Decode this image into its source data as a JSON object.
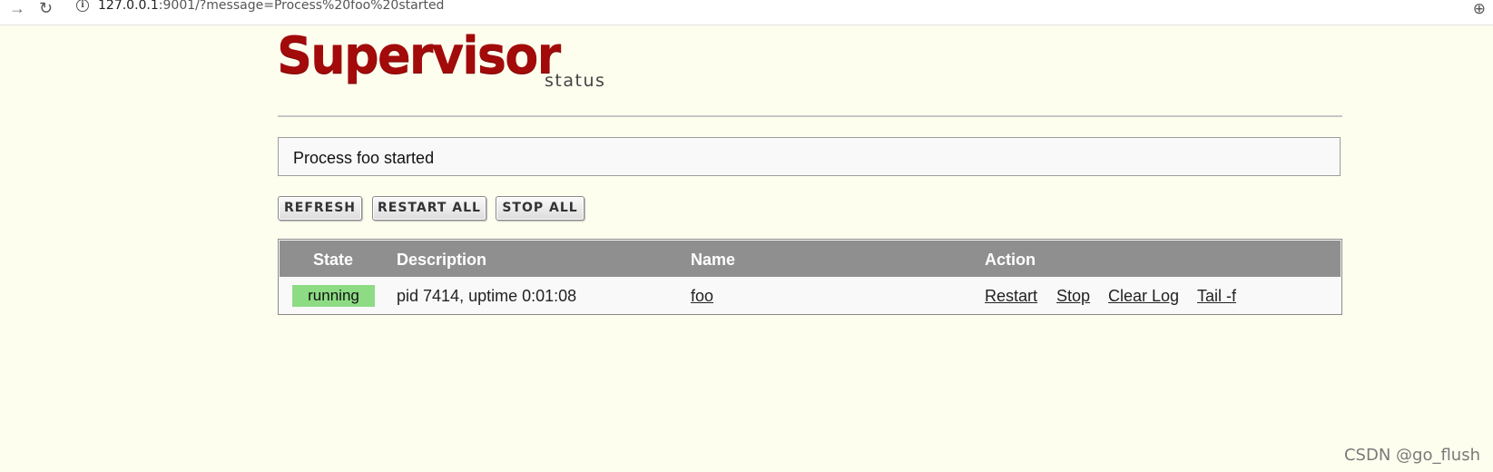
{
  "browser": {
    "url_host": "127.0.0.1",
    "url_rest": ":9001/?message=Process%20foo%20started",
    "icons": [
      "forward-arrow-icon",
      "reload-icon",
      "site-info-icon",
      "zoom-icon"
    ]
  },
  "header": {
    "logo": "Supervisor",
    "subtitle": "status",
    "logo_color": "#a30a0a"
  },
  "message": "Process foo started",
  "toolbar": {
    "refresh_label": "REFRESH",
    "restart_all_label": "RESTART ALL",
    "stop_all_label": "STOP ALL"
  },
  "table": {
    "columns": [
      "State",
      "Description",
      "Name",
      "Action"
    ],
    "rows": [
      {
        "state": "running",
        "state_color": "#8ddc84",
        "description": "pid 7414, uptime 0:01:08",
        "name": "foo",
        "actions": [
          "Restart",
          "Stop",
          "Clear Log",
          "Tail -f"
        ]
      }
    ]
  },
  "watermark": "CSDN @go_flush"
}
